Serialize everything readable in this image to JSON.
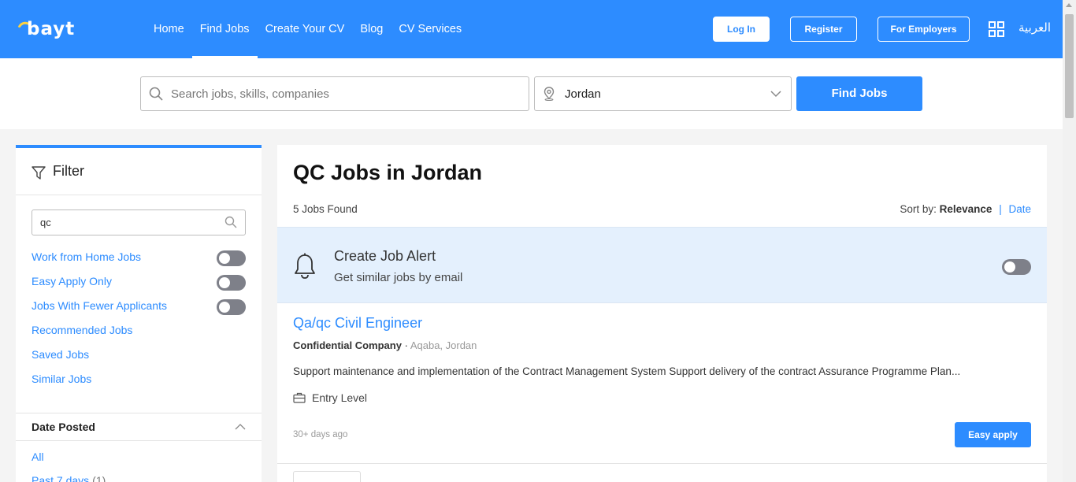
{
  "header": {
    "logo_text": "bayt",
    "nav": [
      {
        "label": "Home",
        "active": false
      },
      {
        "label": "Find Jobs",
        "active": true
      },
      {
        "label": "Create Your CV",
        "active": false
      },
      {
        "label": "Blog",
        "active": false
      },
      {
        "label": "CV Services",
        "active": false
      }
    ],
    "login": "Log In",
    "register": "Register",
    "employers": "For Employers",
    "language": "العربية",
    "apps_icon": "grid-icon"
  },
  "search": {
    "placeholder": "Search jobs, skills, companies",
    "value": "",
    "location": "Jordan",
    "button": "Find Jobs"
  },
  "filter": {
    "title": "Filter",
    "keyword": "qc",
    "toggles": [
      {
        "label": "Work from Home Jobs",
        "on": false
      },
      {
        "label": "Easy Apply Only",
        "on": false
      },
      {
        "label": "Jobs With Fewer Applicants",
        "on": false
      }
    ],
    "links": [
      "Recommended Jobs",
      "Saved Jobs",
      "Similar Jobs"
    ],
    "date_posted": {
      "title": "Date Posted",
      "options": [
        {
          "label": "All",
          "count": ""
        },
        {
          "label": "Past 7 days",
          "count": "(1)"
        }
      ]
    }
  },
  "results": {
    "heading": "QC Jobs in Jordan",
    "count": "5 Jobs Found",
    "sort_label": "Sort by:",
    "sort_relevance": "Relevance",
    "sort_sep": "|",
    "sort_date": "Date"
  },
  "alert": {
    "title": "Create Job Alert",
    "subtitle": "Get similar jobs by email",
    "enabled": false
  },
  "jobs": [
    {
      "title": "Qa/qc Civil Engineer",
      "company": "Confidential Company",
      "separator": "·",
      "location": "Aqaba, Jordan",
      "description": "Support maintenance and implementation of the Contract Management System Support delivery of the contract Assurance Programme Plan...",
      "level": "Entry Level",
      "posted": "30+ days ago",
      "apply": "Easy apply"
    }
  ],
  "colors": {
    "brand": "#2d8cff",
    "toggle_off": "#7e8089",
    "alert_bg": "#e4f0fd"
  }
}
